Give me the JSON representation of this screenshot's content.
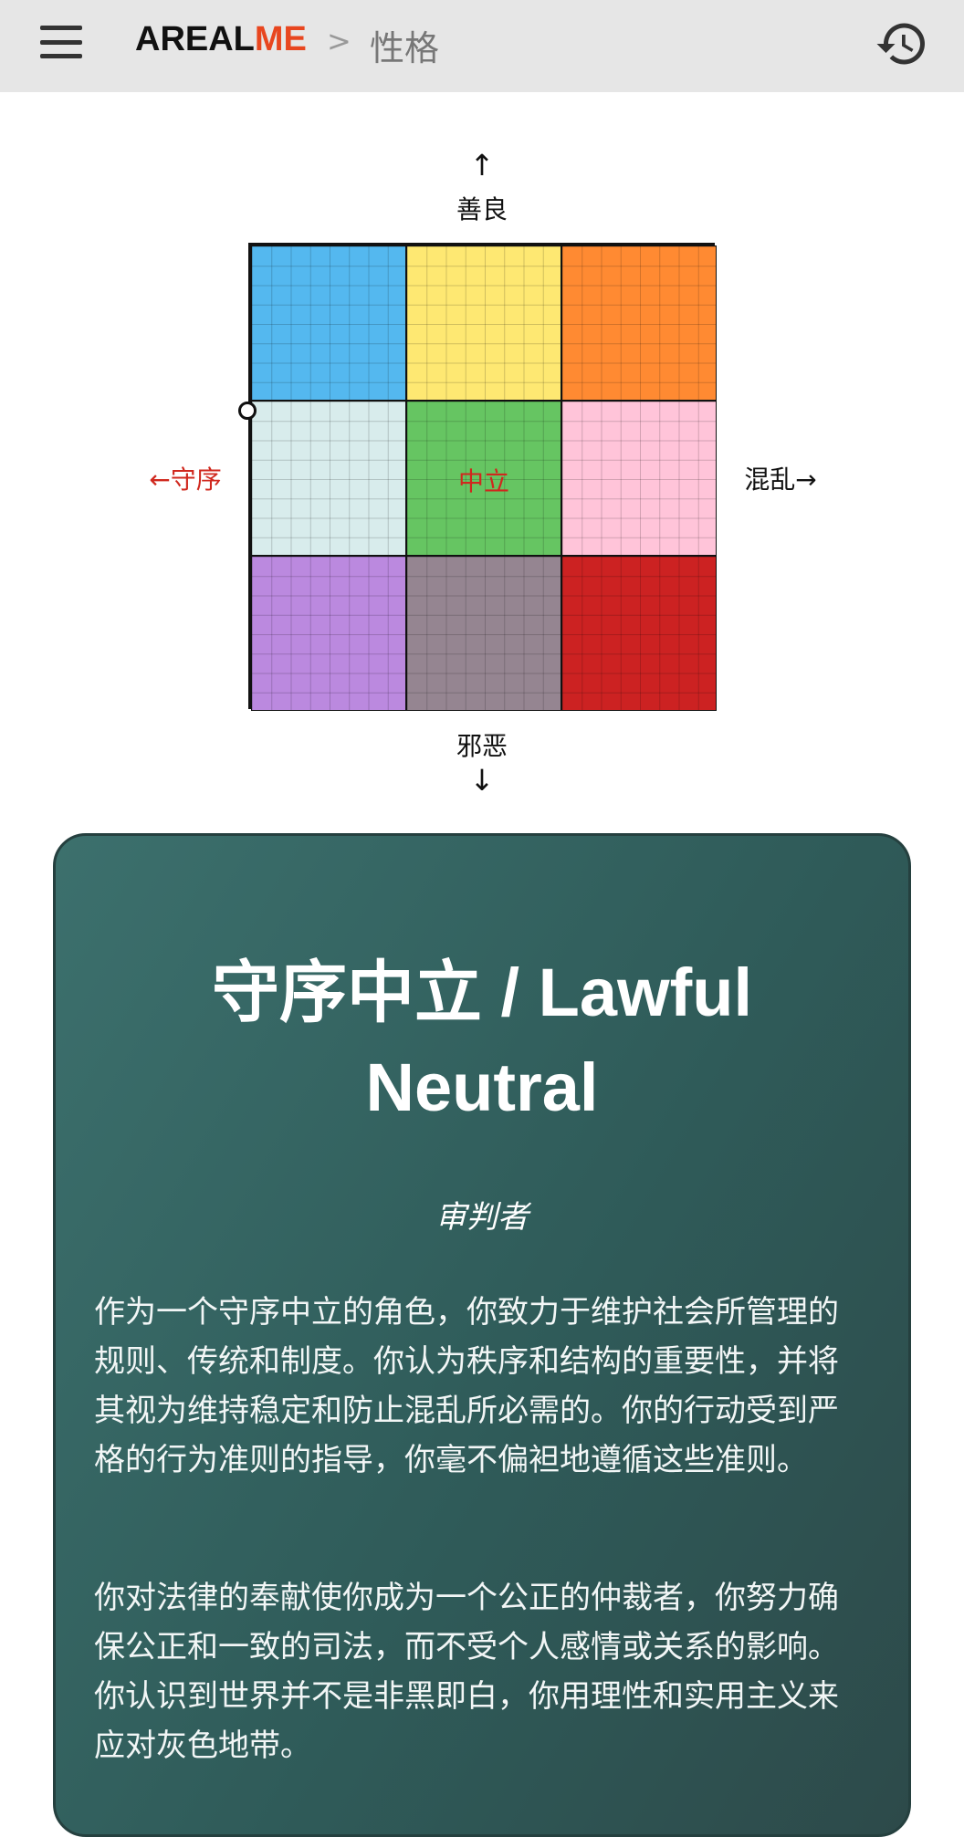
{
  "header": {
    "logo_part1": "AREAL",
    "logo_part2": "ME",
    "separator": ">",
    "breadcrumb": "性格"
  },
  "chart": {
    "top_arrow": "↑",
    "top_label": "善良",
    "bottom_label": "邪恶",
    "bottom_arrow": "↓",
    "left_label": "←守序",
    "right_label": "混乱→",
    "cells": [
      {
        "color": "#54b8ef",
        "label": ""
      },
      {
        "color": "#fee872",
        "label": ""
      },
      {
        "color": "#ff8a32",
        "label": ""
      },
      {
        "color": "#d8ecec",
        "label": ""
      },
      {
        "color": "#66c562",
        "label": "中立"
      },
      {
        "color": "#ffc4d9",
        "label": ""
      },
      {
        "color": "#bb89df",
        "label": ""
      },
      {
        "color": "#958591",
        "label": ""
      },
      {
        "color": "#cc2222",
        "label": ""
      }
    ],
    "highlight_color": "#d0281e"
  },
  "result": {
    "title": "守序中立 / Lawful Neutral",
    "subtitle": "审判者",
    "paragraph1": "作为一个守序中立的角色，你致力于维护社会所管理的规则、传统和制度。你认为秩序和结构的重要性，并将其视为维持稳定和防止混乱所必需的。你的行动受到严格的行为准则的指导，你毫不偏袒地遵循这些准则。",
    "paragraph2": "你对法律的奉献使你成为一个公正的仲裁者，你努力确保公正和一致的司法，而不受个人感情或关系的影响。你认识到世界并不是非黑即白，你用理性和实用主义来应对灰色地带。"
  }
}
